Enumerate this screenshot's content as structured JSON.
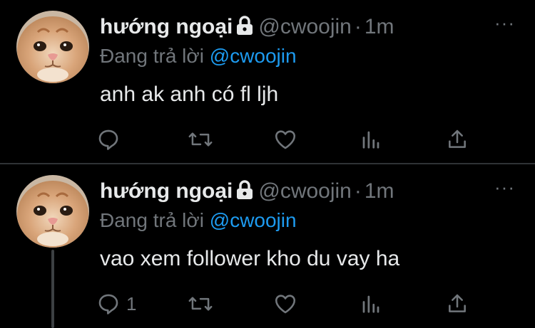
{
  "tweets": [
    {
      "display_name": "hướng ngoại",
      "handle": "@cwoojin",
      "separator": "·",
      "time": "1m",
      "more": "···",
      "replying_prefix": "Đang trả lời",
      "replying_to": "@cwoojin",
      "text": "anh ak anh có fl ljh",
      "reply_count": "",
      "protected_icon": "lock-icon",
      "avatar": "orange-cat-photo"
    },
    {
      "display_name": "hướng ngoại",
      "handle": "@cwoojin",
      "separator": "·",
      "time": "1m",
      "more": "···",
      "replying_prefix": "Đang trả lời",
      "replying_to": "@cwoojin",
      "text": "vao xem follower kho du vay ha",
      "reply_count": "1",
      "protected_icon": "lock-icon",
      "avatar": "orange-cat-photo"
    }
  ],
  "action_icons": [
    "reply-icon",
    "retweet-icon",
    "like-icon",
    "analytics-icon",
    "share-icon"
  ],
  "colors": {
    "background": "#000000",
    "text": "#e7e9ea",
    "muted": "#71767b",
    "link": "#1d9bf0",
    "divider": "#2f3336"
  }
}
